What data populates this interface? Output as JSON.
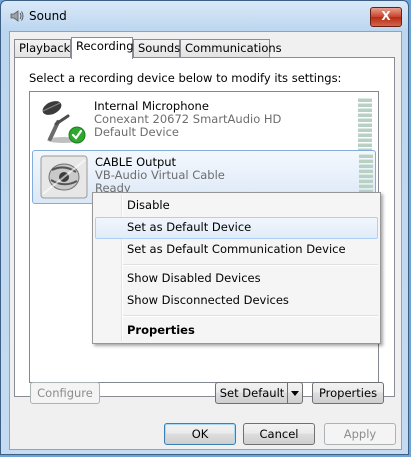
{
  "window": {
    "title": "Sound",
    "close_glyph": "X"
  },
  "tabs": [
    {
      "label": "Playback"
    },
    {
      "label": "Recording"
    },
    {
      "label": "Sounds"
    },
    {
      "label": "Communications"
    }
  ],
  "panel": {
    "instruction": "Select a recording device below to modify its settings:"
  },
  "devices": [
    {
      "name": "Internal Microphone",
      "driver": "Conexant 20672 SmartAudio HD",
      "status": "Default Device",
      "icon": "microphone-icon"
    },
    {
      "name": "CABLE Output",
      "driver": "VB-Audio Virtual Cable",
      "status": "Ready",
      "icon": "cable-icon"
    }
  ],
  "context_menu": {
    "items": [
      {
        "label": "Disable"
      },
      {
        "label": "Set as Default Device"
      },
      {
        "label": "Set as Default Communication Device"
      },
      {
        "label": "Show Disabled Devices"
      },
      {
        "label": "Show Disconnected Devices"
      },
      {
        "label": "Properties"
      }
    ]
  },
  "panel_buttons": {
    "configure": "Configure",
    "set_default": "Set Default",
    "properties": "Properties"
  },
  "dialog_buttons": {
    "ok": "OK",
    "cancel": "Cancel",
    "apply": "Apply"
  },
  "colors": {
    "selection_border": "#84acdd",
    "close_button": "#c7432a",
    "check_green": "#2fa82f"
  }
}
